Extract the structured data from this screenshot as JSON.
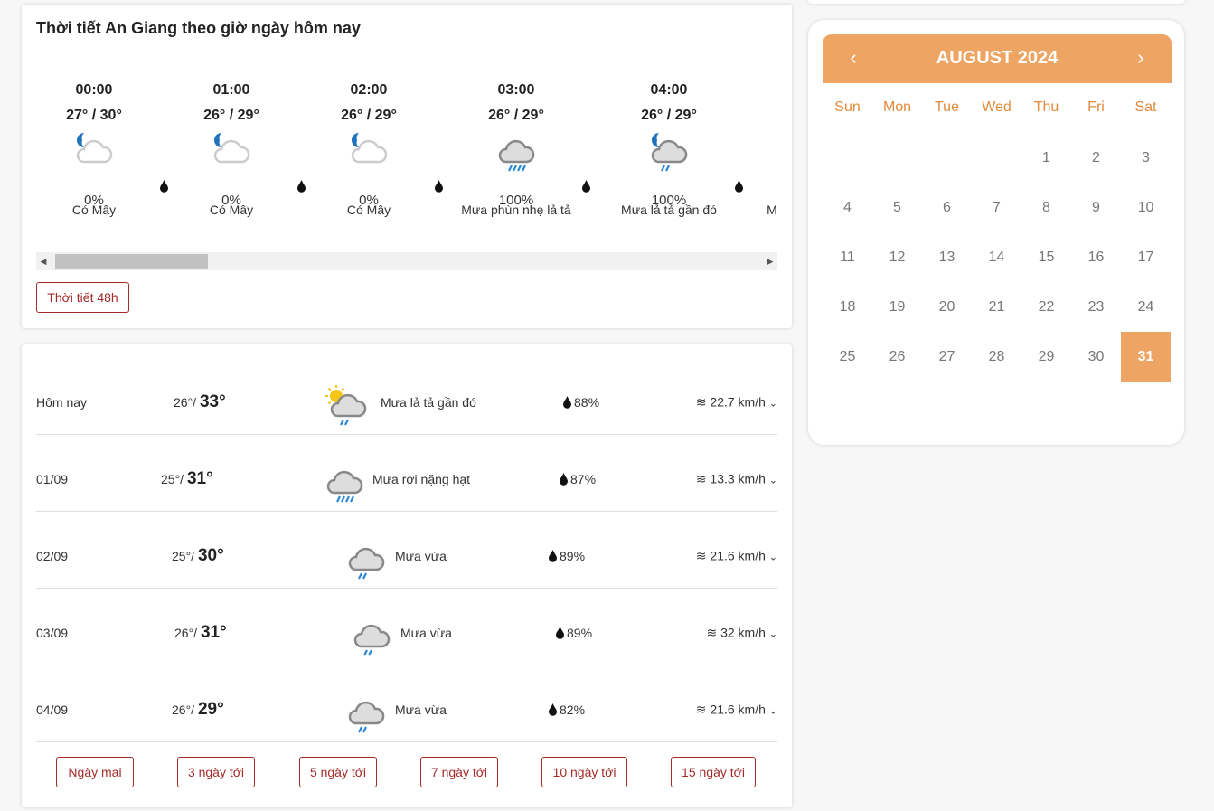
{
  "hourly": {
    "title": "Thời tiết An Giang theo giờ ngày hôm nay",
    "items": [
      {
        "time": "00:00",
        "temp": "27° / 30°",
        "icon": "moon-cloud-icon",
        "precip": "0%",
        "desc": "Có Mây"
      },
      {
        "time": "01:00",
        "temp": "26° / 29°",
        "icon": "moon-cloud-icon",
        "precip": "0%",
        "desc": "Có Mây"
      },
      {
        "time": "02:00",
        "temp": "26° / 29°",
        "icon": "moon-cloud-icon",
        "precip": "0%",
        "desc": "Có Mây"
      },
      {
        "time": "03:00",
        "temp": "26° / 29°",
        "icon": "rain-cloud-icon",
        "precip": "100%",
        "desc": "Mưa phùn nhẹ lả tả"
      },
      {
        "time": "04:00",
        "temp": "26° / 29°",
        "icon": "moon-rain-cloud-icon",
        "precip": "100%",
        "desc": "Mưa lả tả gần đó"
      },
      {
        "time": "",
        "temp": "",
        "icon": "",
        "precip": "",
        "desc": "M"
      }
    ],
    "button": "Thời tiết 48h"
  },
  "daily": {
    "rows": [
      {
        "date": "Hôm nay",
        "low": "26°",
        "high": "33°",
        "icon": "sun-rain-cloud-icon",
        "desc": "Mưa lả tả gần đó",
        "humidity": "88%",
        "wind": "22.7 km/h"
      },
      {
        "date": "01/09",
        "low": "25°",
        "high": "31°",
        "icon": "heavy-rain-cloud-icon",
        "desc": "Mưa rơi nặng hạt",
        "humidity": "87%",
        "wind": "13.3 km/h"
      },
      {
        "date": "02/09",
        "low": "25°",
        "high": "30°",
        "icon": "rain-cloud-icon",
        "desc": "Mưa vừa",
        "humidity": "89%",
        "wind": "21.6 km/h"
      },
      {
        "date": "03/09",
        "low": "26°",
        "high": "31°",
        "icon": "rain-cloud-icon",
        "desc": "Mưa vừa",
        "humidity": "89%",
        "wind": "32 km/h"
      },
      {
        "date": "04/09",
        "low": "26°",
        "high": "29°",
        "icon": "rain-cloud-icon",
        "desc": "Mưa vừa",
        "humidity": "82%",
        "wind": "21.6 km/h"
      }
    ],
    "buttons": [
      "Ngày mai",
      "3 ngày tới",
      "5 ngày tới",
      "7 ngày tới",
      "10 ngày tới",
      "15 ngày tới"
    ]
  },
  "calendar": {
    "title": "AUGUST 2024",
    "weekdays": [
      "Sun",
      "Mon",
      "Tue",
      "Wed",
      "Thu",
      "Fri",
      "Sat"
    ],
    "selected": "31",
    "accent": "#eea462",
    "days": [
      "1",
      "2",
      "3",
      "4",
      "5",
      "6",
      "7",
      "8",
      "9",
      "10",
      "11",
      "12",
      "13",
      "14",
      "15",
      "16",
      "17",
      "18",
      "19",
      "20",
      "21",
      "22",
      "23",
      "24",
      "25",
      "26",
      "27",
      "28",
      "29",
      "30",
      "31"
    ]
  }
}
